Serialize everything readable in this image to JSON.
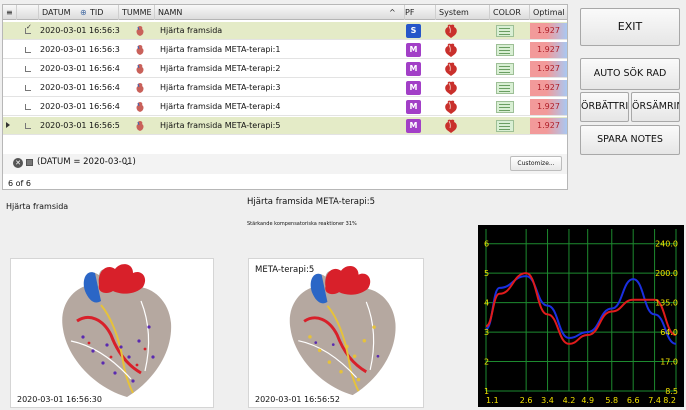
{
  "grid": {
    "columns": [
      "DATUM",
      "TID",
      "TUMME",
      "NAMN",
      "PF",
      "System",
      "COLOR",
      "Optimal S"
    ],
    "rows": [
      {
        "datetime": "2020-03-01 16:56:3",
        "name": "Hjärta framsida",
        "pf": "S",
        "pf_color": "#2656c9",
        "optimal": "1.927",
        "checked": true
      },
      {
        "datetime": "2020-03-01 16:56:3",
        "name": "Hjärta framsida META-terapi:1",
        "pf": "M",
        "pf_color": "#a23fc7",
        "optimal": "1.927",
        "checked": false
      },
      {
        "datetime": "2020-03-01 16:56:4",
        "name": "Hjärta framsida META-terapi:2",
        "pf": "M",
        "pf_color": "#a23fc7",
        "optimal": "1.927",
        "checked": false
      },
      {
        "datetime": "2020-03-01 16:56:4",
        "name": "Hjärta framsida META-terapi:3",
        "pf": "M",
        "pf_color": "#a23fc7",
        "optimal": "1.927",
        "checked": false
      },
      {
        "datetime": "2020-03-01 16:56:4",
        "name": "Hjärta framsida META-terapi:4",
        "pf": "M",
        "pf_color": "#a23fc7",
        "optimal": "1.927",
        "checked": false
      },
      {
        "datetime": "2020-03-01 16:56:5",
        "name": "Hjärta framsida META-terapi:5",
        "pf": "M",
        "pf_color": "#a23fc7",
        "optimal": "1.927",
        "checked": false
      }
    ],
    "filter_text": "(DATUM = 2020-03-01)",
    "filter_dropdown": "⌄",
    "customize_label": "Customize...",
    "count_label": "6 of 6"
  },
  "buttons": {
    "exit": "EXIT",
    "auto_sok_rad": "AUTO SÖK RAD",
    "forbattring": "ÖRBÄTTRIN",
    "forsamring": "ÖRSÄMRIN",
    "spara_notes": "SPARA NOTES"
  },
  "left_panel": {
    "title": "Hjärta framsida",
    "timestamp": "2020-03-01 16:56:30"
  },
  "middle_panel": {
    "title": "Hjärta framsida META-terapi:5",
    "subtitle": "Stärkande kompensatoriska reaktioner 31%",
    "image_label": "META-terapi:5",
    "timestamp": "2020-03-01 16:56:52"
  },
  "chart_data": {
    "type": "line",
    "x_ticks": [
      "1.1",
      "2.6",
      "3.4",
      "4.2",
      "4.9",
      "5.8",
      "6.6",
      "7.4",
      "8.2"
    ],
    "left_y_ticks": [
      "6",
      "5",
      "4",
      "3",
      "2",
      "1"
    ],
    "right_y_ticks": [
      "240.0",
      "200.0",
      "135.0",
      "64.0",
      "17.0",
      "8.5"
    ],
    "ylim": [
      1,
      6.5
    ],
    "series": [
      {
        "color": "#1a2fe0",
        "x": [
          1.1,
          1.6,
          2.6,
          3.4,
          4.2,
          4.9,
          5.8,
          6.6,
          7.4,
          8.2
        ],
        "values": [
          3.1,
          4.5,
          4.9,
          3.9,
          2.8,
          3.0,
          3.8,
          4.8,
          3.6,
          2.6
        ]
      },
      {
        "color": "#e01b1b",
        "x": [
          1.1,
          1.6,
          2.6,
          3.4,
          4.2,
          4.9,
          5.8,
          6.6,
          7.4,
          8.2
        ],
        "values": [
          3.2,
          4.3,
          5.0,
          3.6,
          2.6,
          2.9,
          3.7,
          4.1,
          4.1,
          2.9
        ]
      }
    ],
    "grid": true,
    "grid_color": "#1d8a2f",
    "text_color": "#f2e200"
  }
}
